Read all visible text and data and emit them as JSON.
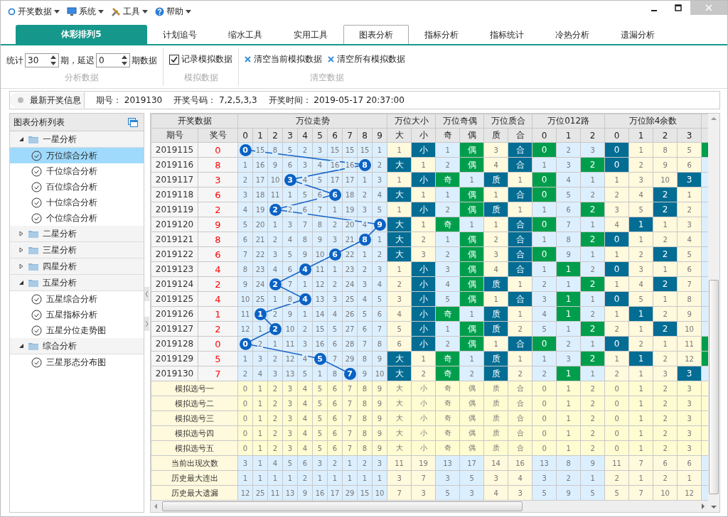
{
  "menu": [
    {
      "label": "开奖数据"
    },
    {
      "label": "系统"
    },
    {
      "label": "工具"
    },
    {
      "label": "帮助"
    }
  ],
  "lottery_tab": "体彩排列5",
  "tabs": [
    {
      "label": "计划追号",
      "selected": false
    },
    {
      "label": "缩水工具",
      "selected": false
    },
    {
      "label": "实用工具",
      "selected": false
    },
    {
      "label": "图表分析",
      "selected": true
    },
    {
      "label": "指标分析",
      "selected": false
    },
    {
      "label": "指标统计",
      "selected": false
    },
    {
      "label": "冷热分析",
      "selected": false
    },
    {
      "label": "遗漏分析",
      "selected": false
    }
  ],
  "toolbar": {
    "stat_label": "统计",
    "periods": "30",
    "period_unit": "期，延迟",
    "delay": "0",
    "delay_unit": "期数据",
    "section_1": "分析数据",
    "record_label": "记录模拟数据",
    "record_checked": true,
    "section_2": "模拟数据",
    "clear_current": "清空当前模拟数据",
    "clear_all": "清空所有模拟数据",
    "section_3": "清空数据"
  },
  "info_bar": {
    "button": "最新开奖信息",
    "period": "期号： 2019130",
    "numbers": "开奖号码： 7,2,5,3,3",
    "time": "开奖时间： 2019-05-17 20:37:00"
  },
  "sidebar": {
    "title": "图表分析列表",
    "items": [
      {
        "label": "一星分析",
        "expanded": true,
        "children": [
          {
            "label": "万位综合分析",
            "selected": true
          },
          {
            "label": "千位综合分析",
            "selected": false
          },
          {
            "label": "百位综合分析",
            "selected": false
          },
          {
            "label": "十位综合分析",
            "selected": false
          },
          {
            "label": "个位综合分析",
            "selected": false
          }
        ]
      },
      {
        "label": "二星分析",
        "expanded": false
      },
      {
        "label": "三星分析",
        "expanded": false
      },
      {
        "label": "四星分析",
        "expanded": false
      },
      {
        "label": "五星分析",
        "expanded": true,
        "children": [
          {
            "label": "五星综合分析",
            "selected": false
          },
          {
            "label": "五星指标分析",
            "selected": false
          },
          {
            "label": "五星分位走势图",
            "selected": false
          }
        ]
      },
      {
        "label": "综合分析",
        "expanded": true,
        "children": [
          {
            "label": "三星形态分布图",
            "selected": false
          }
        ]
      }
    ]
  },
  "table": {
    "header_group": "开奖数据",
    "period_header": "期号",
    "number_header": "奖号",
    "groups": [
      {
        "label": "万位走势",
        "kind": "trend",
        "color": "#0a62c4",
        "columns": [
          "0",
          "1",
          "2",
          "3",
          "4",
          "5",
          "6",
          "7",
          "8",
          "9"
        ]
      },
      {
        "label": "万位大小",
        "kind": "plain",
        "color": "#036d94",
        "columns": [
          "大",
          "小"
        ]
      },
      {
        "label": "万位奇偶",
        "kind": "plain",
        "color": "#009e4c",
        "columns": [
          "奇",
          "偶"
        ]
      },
      {
        "label": "万位质合",
        "kind": "plain",
        "color": "#036d94",
        "columns": [
          "质",
          "合"
        ]
      },
      {
        "label": "万位012路",
        "kind": "plain",
        "color": "#009e4c",
        "columns": [
          "0",
          "1",
          "2"
        ]
      },
      {
        "label": "万位除4余数",
        "kind": "plain",
        "color": "#036d94",
        "columns": [
          "0",
          "1",
          "2",
          "3"
        ]
      }
    ],
    "edge": {
      "color": "#009e4c"
    },
    "rows": [
      {
        "period": "2019115",
        "number": "0",
        "cells": [
          "0",
          "15",
          "8",
          "5",
          "2",
          "3",
          "15",
          "15",
          "15",
          "1",
          "1",
          "小",
          "1",
          "偶",
          "3",
          "合",
          "0",
          "2",
          "3",
          "0",
          "1",
          "8",
          "5"
        ],
        "hits": [
          true,
          false,
          false,
          false,
          false,
          false,
          false,
          false,
          false,
          false,
          false,
          true,
          false,
          true,
          false,
          true,
          true,
          false,
          false,
          true,
          false,
          false,
          false
        ],
        "edge_hit": true
      },
      {
        "period": "2019116",
        "number": "8",
        "cells": [
          "1",
          "16",
          "9",
          "6",
          "3",
          "4",
          "16",
          "16",
          "8",
          "2",
          "大",
          "1",
          "2",
          "偶",
          "4",
          "合",
          "1",
          "3",
          "2",
          "0",
          "2",
          "9",
          "6"
        ],
        "hits": [
          false,
          false,
          false,
          false,
          false,
          false,
          false,
          false,
          true,
          false,
          true,
          false,
          false,
          true,
          false,
          true,
          false,
          false,
          true,
          true,
          false,
          false,
          false
        ],
        "edge_hit": false
      },
      {
        "period": "2019117",
        "number": "3",
        "cells": [
          "2",
          "17",
          "10",
          "3",
          "4",
          "5",
          "17",
          "17",
          "1",
          "3",
          "1",
          "小",
          "奇",
          "1",
          "质",
          "1",
          "0",
          "4",
          "1",
          "1",
          "3",
          "10",
          "3"
        ],
        "hits": [
          false,
          false,
          false,
          true,
          false,
          false,
          false,
          false,
          false,
          false,
          false,
          true,
          true,
          false,
          true,
          false,
          true,
          false,
          false,
          false,
          false,
          false,
          true
        ],
        "edge_hit": false
      },
      {
        "period": "2019118",
        "number": "6",
        "cells": [
          "3",
          "18",
          "11",
          "1",
          "5",
          "6",
          "6",
          "18",
          "2",
          "4",
          "大",
          "1",
          "1",
          "偶",
          "1",
          "合",
          "0",
          "5",
          "2",
          "2",
          "4",
          "2",
          "1"
        ],
        "hits": [
          false,
          false,
          false,
          false,
          false,
          false,
          true,
          false,
          false,
          false,
          true,
          false,
          false,
          true,
          false,
          true,
          true,
          false,
          false,
          false,
          false,
          true,
          false
        ],
        "edge_hit": false
      },
      {
        "period": "2019119",
        "number": "2",
        "cells": [
          "4",
          "19",
          "2",
          "2",
          "6",
          "7",
          "1",
          "19",
          "3",
          "5",
          "1",
          "小",
          "2",
          "偶",
          "质",
          "1",
          "1",
          "6",
          "2",
          "3",
          "5",
          "2",
          "2"
        ],
        "hits": [
          false,
          false,
          true,
          false,
          false,
          false,
          false,
          false,
          false,
          false,
          false,
          true,
          false,
          true,
          true,
          false,
          false,
          false,
          true,
          false,
          false,
          true,
          false
        ],
        "edge_hit": false
      },
      {
        "period": "2019120",
        "number": "9",
        "cells": [
          "5",
          "20",
          "1",
          "3",
          "7",
          "8",
          "2",
          "20",
          "4",
          "9",
          "大",
          "1",
          "奇",
          "1",
          "1",
          "合",
          "0",
          "7",
          "1",
          "4",
          "1",
          "1",
          "3"
        ],
        "hits": [
          false,
          false,
          false,
          false,
          false,
          false,
          false,
          false,
          false,
          true,
          true,
          false,
          true,
          false,
          false,
          true,
          true,
          false,
          false,
          false,
          true,
          false,
          false
        ],
        "edge_hit": false
      },
      {
        "period": "2019121",
        "number": "8",
        "cells": [
          "6",
          "21",
          "2",
          "4",
          "8",
          "9",
          "3",
          "21",
          "8",
          "1",
          "大",
          "2",
          "1",
          "偶",
          "2",
          "合",
          "1",
          "8",
          "2",
          "0",
          "1",
          "2",
          "4"
        ],
        "hits": [
          false,
          false,
          false,
          false,
          false,
          false,
          false,
          false,
          true,
          false,
          true,
          false,
          false,
          true,
          false,
          true,
          false,
          false,
          true,
          true,
          false,
          false,
          false
        ],
        "edge_hit": false
      },
      {
        "period": "2019122",
        "number": "6",
        "cells": [
          "7",
          "22",
          "3",
          "5",
          "9",
          "10",
          "6",
          "22",
          "1",
          "2",
          "大",
          "3",
          "2",
          "偶",
          "3",
          "合",
          "0",
          "9",
          "1",
          "1",
          "2",
          "2",
          "5"
        ],
        "hits": [
          false,
          false,
          false,
          false,
          false,
          false,
          true,
          false,
          false,
          false,
          true,
          false,
          false,
          true,
          false,
          true,
          true,
          false,
          false,
          false,
          false,
          true,
          false
        ],
        "edge_hit": false
      },
      {
        "period": "2019123",
        "number": "4",
        "cells": [
          "8",
          "23",
          "4",
          "6",
          "4",
          "11",
          "1",
          "23",
          "2",
          "3",
          "1",
          "小",
          "3",
          "偶",
          "4",
          "合",
          "1",
          "1",
          "2",
          "0",
          "3",
          "1",
          "6"
        ],
        "hits": [
          false,
          false,
          false,
          false,
          true,
          false,
          false,
          false,
          false,
          false,
          false,
          true,
          false,
          true,
          false,
          true,
          false,
          true,
          false,
          true,
          false,
          false,
          false
        ],
        "edge_hit": false
      },
      {
        "period": "2019124",
        "number": "2",
        "cells": [
          "9",
          "24",
          "2",
          "7",
          "1",
          "12",
          "2",
          "24",
          "3",
          "4",
          "2",
          "小",
          "4",
          "偶",
          "质",
          "1",
          "2",
          "1",
          "2",
          "1",
          "4",
          "2",
          "7"
        ],
        "hits": [
          false,
          false,
          true,
          false,
          false,
          false,
          false,
          false,
          false,
          false,
          false,
          true,
          false,
          true,
          true,
          false,
          false,
          false,
          true,
          false,
          false,
          true,
          false
        ],
        "edge_hit": false
      },
      {
        "period": "2019125",
        "number": "4",
        "cells": [
          "10",
          "25",
          "1",
          "8",
          "4",
          "13",
          "3",
          "25",
          "4",
          "5",
          "3",
          "小",
          "5",
          "偶",
          "1",
          "合",
          "3",
          "1",
          "1",
          "0",
          "5",
          "1",
          "8"
        ],
        "hits": [
          false,
          false,
          false,
          false,
          true,
          false,
          false,
          false,
          false,
          false,
          false,
          true,
          false,
          true,
          false,
          true,
          false,
          true,
          false,
          true,
          false,
          false,
          false
        ],
        "edge_hit": false
      },
      {
        "period": "2019126",
        "number": "1",
        "cells": [
          "11",
          "1",
          "2",
          "9",
          "1",
          "14",
          "4",
          "26",
          "5",
          "6",
          "4",
          "小",
          "奇",
          "1",
          "质",
          "1",
          "4",
          "1",
          "2",
          "1",
          "1",
          "2",
          "9"
        ],
        "hits": [
          false,
          true,
          false,
          false,
          false,
          false,
          false,
          false,
          false,
          false,
          false,
          true,
          true,
          false,
          true,
          false,
          false,
          true,
          false,
          false,
          true,
          false,
          false
        ],
        "edge_hit": false
      },
      {
        "period": "2019127",
        "number": "2",
        "cells": [
          "12",
          "1",
          "2",
          "10",
          "2",
          "15",
          "5",
          "27",
          "6",
          "7",
          "5",
          "小",
          "1",
          "偶",
          "质",
          "2",
          "5",
          "1",
          "2",
          "2",
          "1",
          "2",
          "10"
        ],
        "hits": [
          false,
          false,
          true,
          false,
          false,
          false,
          false,
          false,
          false,
          false,
          false,
          true,
          false,
          true,
          true,
          false,
          false,
          false,
          true,
          false,
          false,
          true,
          false
        ],
        "edge_hit": false
      },
      {
        "period": "2019128",
        "number": "0",
        "cells": [
          "0",
          "2",
          "1",
          "11",
          "3",
          "16",
          "6",
          "28",
          "7",
          "8",
          "6",
          "小",
          "2",
          "偶",
          "1",
          "合",
          "0",
          "2",
          "1",
          "0",
          "2",
          "1",
          "11"
        ],
        "hits": [
          true,
          false,
          false,
          false,
          false,
          false,
          false,
          false,
          false,
          false,
          false,
          true,
          false,
          true,
          false,
          true,
          true,
          false,
          false,
          true,
          false,
          false,
          false
        ],
        "edge_hit": true
      },
      {
        "period": "2019129",
        "number": "5",
        "cells": [
          "1",
          "3",
          "2",
          "12",
          "4",
          "5",
          "7",
          "29",
          "8",
          "9",
          "大",
          "1",
          "奇",
          "1",
          "质",
          "1",
          "1",
          "3",
          "2",
          "1",
          "1",
          "2",
          "12"
        ],
        "hits": [
          false,
          false,
          false,
          false,
          false,
          true,
          false,
          false,
          false,
          false,
          true,
          false,
          true,
          false,
          true,
          false,
          false,
          false,
          true,
          false,
          true,
          false,
          false
        ],
        "edge_hit": true
      },
      {
        "period": "2019130",
        "number": "7",
        "cells": [
          "2",
          "4",
          "3",
          "13",
          "5",
          "1",
          "8",
          "7",
          "9",
          "10",
          "大",
          "2",
          "奇",
          "2",
          "质",
          "2",
          "2",
          "1",
          "1",
          "2",
          "1",
          "3",
          "3"
        ],
        "hits": [
          false,
          false,
          false,
          false,
          false,
          false,
          false,
          true,
          false,
          false,
          true,
          false,
          true,
          false,
          true,
          false,
          false,
          true,
          false,
          false,
          false,
          false,
          true
        ],
        "edge_hit": false
      }
    ],
    "summary": [
      {
        "kind": "sim",
        "label": "模拟选号一",
        "cells": [
          "0",
          "1",
          "2",
          "3",
          "4",
          "5",
          "6",
          "7",
          "8",
          "9",
          "大",
          "小",
          "奇",
          "偶",
          "质",
          "合",
          "0",
          "1",
          "2",
          "0",
          "1",
          "2",
          "3"
        ]
      },
      {
        "kind": "sim",
        "label": "模拟选号二",
        "cells": [
          "0",
          "1",
          "2",
          "3",
          "4",
          "5",
          "6",
          "7",
          "8",
          "9",
          "大",
          "小",
          "奇",
          "偶",
          "质",
          "合",
          "0",
          "1",
          "2",
          "0",
          "1",
          "2",
          "3"
        ]
      },
      {
        "kind": "sim",
        "label": "模拟选号三",
        "cells": [
          "0",
          "1",
          "2",
          "3",
          "4",
          "5",
          "6",
          "7",
          "8",
          "9",
          "大",
          "小",
          "奇",
          "偶",
          "质",
          "合",
          "0",
          "1",
          "2",
          "0",
          "1",
          "2",
          "3"
        ]
      },
      {
        "kind": "sim",
        "label": "模拟选号四",
        "cells": [
          "0",
          "1",
          "2",
          "3",
          "4",
          "5",
          "6",
          "7",
          "8",
          "9",
          "大",
          "小",
          "奇",
          "偶",
          "质",
          "合",
          "0",
          "1",
          "2",
          "0",
          "1",
          "2",
          "3"
        ]
      },
      {
        "kind": "sim",
        "label": "模拟选号五",
        "cells": [
          "0",
          "1",
          "2",
          "3",
          "4",
          "5",
          "6",
          "7",
          "8",
          "9",
          "大",
          "小",
          "奇",
          "偶",
          "质",
          "合",
          "0",
          "1",
          "2",
          "0",
          "1",
          "2",
          "3"
        ]
      },
      {
        "kind": "stat",
        "label": "当前出现次数",
        "cells": [
          "3",
          "1",
          "4",
          "5",
          "6",
          "3",
          "2",
          "1",
          "2",
          "3",
          "11",
          "19",
          "13",
          "17",
          "14",
          "16",
          "13",
          "8",
          "9",
          "11",
          "7",
          "6",
          "6"
        ]
      },
      {
        "kind": "stat",
        "label": "历史最大连出",
        "cells": [
          "1",
          "1",
          "1",
          "1",
          "2",
          "1",
          "1",
          "1",
          "1",
          "1",
          "3",
          "7",
          "3",
          "5",
          "3",
          "4",
          "3",
          "2",
          "1",
          "2",
          "1",
          "2",
          "1"
        ]
      },
      {
        "kind": "stat",
        "label": "历史最大遗漏",
        "cells": [
          "12",
          "25",
          "11",
          "13",
          "9",
          "16",
          "17",
          "29",
          "15",
          "10",
          "7",
          "3",
          "5",
          "3",
          "4",
          "3",
          "5",
          "9",
          "5",
          "5",
          "7",
          "10",
          "12"
        ]
      }
    ]
  }
}
